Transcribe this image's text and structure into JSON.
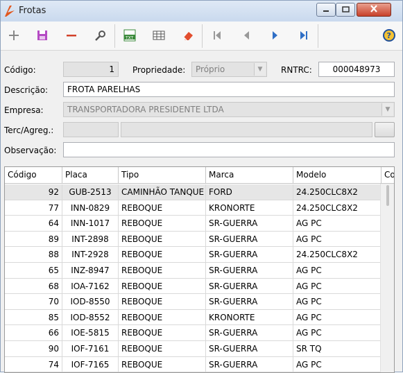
{
  "window": {
    "title": "Frotas"
  },
  "toolbar": {
    "buttons": [
      "add",
      "save",
      "delete",
      "search",
      "export-txt",
      "grid-view",
      "eraser",
      "first",
      "previous",
      "next",
      "last",
      "help"
    ]
  },
  "form": {
    "codigo_label": "Código:",
    "codigo_value": "1",
    "propriedade_label": "Propriedade:",
    "propriedade_value": "Próprio",
    "rntrc_label": "RNTRC:",
    "rntrc_value": "000048973",
    "descricao_label": "Descrição:",
    "descricao_value": "FROTA PARELHAS",
    "empresa_label": "Empresa:",
    "empresa_value": "TRANSPORTADORA PRESIDENTE LTDA",
    "terc_label": "Terc/Agreg.:",
    "observacao_label": "Observação:"
  },
  "grid": {
    "headers": [
      "Código",
      "Placa",
      "Tipo",
      "Marca",
      "Modelo",
      "Co"
    ],
    "rows": [
      [
        "92",
        "GUB-2513",
        "CAMINHÃO TANQUE",
        "FORD",
        "24.250CLC8X2"
      ],
      [
        "77",
        "INN-0829",
        "REBOQUE",
        "KRONORTE",
        "24.250CLC8X2"
      ],
      [
        "64",
        "INN-1017",
        "REBOQUE",
        "SR-GUERRA",
        "AG PC"
      ],
      [
        "89",
        "INT-2898",
        "REBOQUE",
        "SR-GUERRA",
        "AG PC"
      ],
      [
        "88",
        "INT-2928",
        "REBOQUE",
        "SR-GUERRA",
        "24.250CLC8X2"
      ],
      [
        "65",
        "INZ-8947",
        "REBOQUE",
        "SR-GUERRA",
        "AG PC"
      ],
      [
        "68",
        "IOA-7162",
        "REBOQUE",
        "SR-GUERRA",
        "AG PC"
      ],
      [
        "70",
        "IOD-8550",
        "REBOQUE",
        "SR-GUERRA",
        "AG PC"
      ],
      [
        "85",
        "IOD-8552",
        "REBOQUE",
        "KRONORTE",
        "AG PC"
      ],
      [
        "66",
        "IOE-5815",
        "REBOQUE",
        "SR-GUERRA",
        "AG PC"
      ],
      [
        "90",
        "IOF-7161",
        "REBOQUE",
        "SR-GUERRA",
        "SR TQ"
      ],
      [
        "74",
        "IOF-7165",
        "REBOQUE",
        "SR-GUERRA",
        "AG PC"
      ]
    ]
  }
}
